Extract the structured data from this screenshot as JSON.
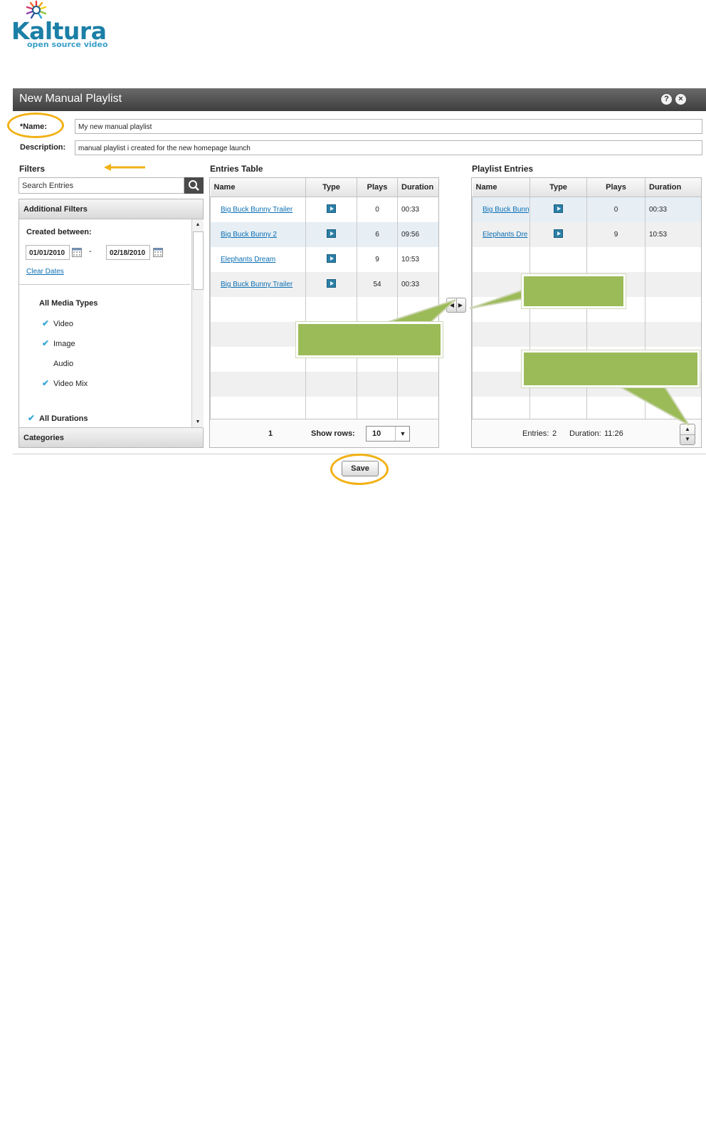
{
  "logo": {
    "name": "Kaltura",
    "tagline": "open source video"
  },
  "dialog": {
    "title": "New Manual Playlist",
    "help_icon": "?",
    "close_icon": "×"
  },
  "form": {
    "name_label": "*Name:",
    "name_value": "My new manual playlist",
    "description_label": "Description:",
    "description_value": "manual playlist i created for the new homepage launch"
  },
  "filters": {
    "heading": "Filters",
    "search_placeholder": "Search  Entries",
    "additional_filters": "Additional Filters",
    "created_between": "Created between:",
    "date_from": "01/01/2010",
    "date_sep": "-",
    "date_to": "02/18/2010",
    "clear_dates": "Clear Dates",
    "media_types_heading": "All Media Types",
    "media_types": [
      {
        "label": "Video",
        "checked": true
      },
      {
        "label": "Image",
        "checked": true
      },
      {
        "label": "Audio",
        "checked": false
      },
      {
        "label": "Video Mix",
        "checked": true
      }
    ],
    "all_durations": "All Durations",
    "categories": "Categories"
  },
  "entries_table": {
    "heading": "Entries Table",
    "columns": [
      "Name",
      "Type",
      "Plays",
      "Duration"
    ],
    "rows": [
      {
        "name": "Big Buck Bunny Trailer",
        "plays": "0",
        "duration": "00:33"
      },
      {
        "name": "Big Buck Bunny  2",
        "plays": "6",
        "duration": "09:56"
      },
      {
        "name": "Elephants Dream",
        "plays": "9",
        "duration": "10:53"
      },
      {
        "name": "Big Buck Bunny Trailer",
        "plays": "54",
        "duration": "00:33"
      }
    ],
    "page": "1",
    "show_rows_label": "Show rows:",
    "show_rows_value": "10"
  },
  "playlist_entries": {
    "heading": "Playlist Entries",
    "columns": [
      "Name",
      "Type",
      "Plays",
      "Duration"
    ],
    "rows": [
      {
        "name": "Big Buck Bunny",
        "plays": "0",
        "duration": "00:33"
      },
      {
        "name": "Elephants Dre",
        "plays": "9",
        "duration": "10:53"
      }
    ],
    "entries_label": "Entries:",
    "entries_count": "2",
    "duration_label": "Duration:",
    "duration_total": "11:26"
  },
  "save_label": "Save",
  "colors": {
    "title_bar": "#4a4a4a",
    "callout": "#9bbb59",
    "highlight_circle": "#f2b115",
    "link": "#0c6fb3"
  }
}
